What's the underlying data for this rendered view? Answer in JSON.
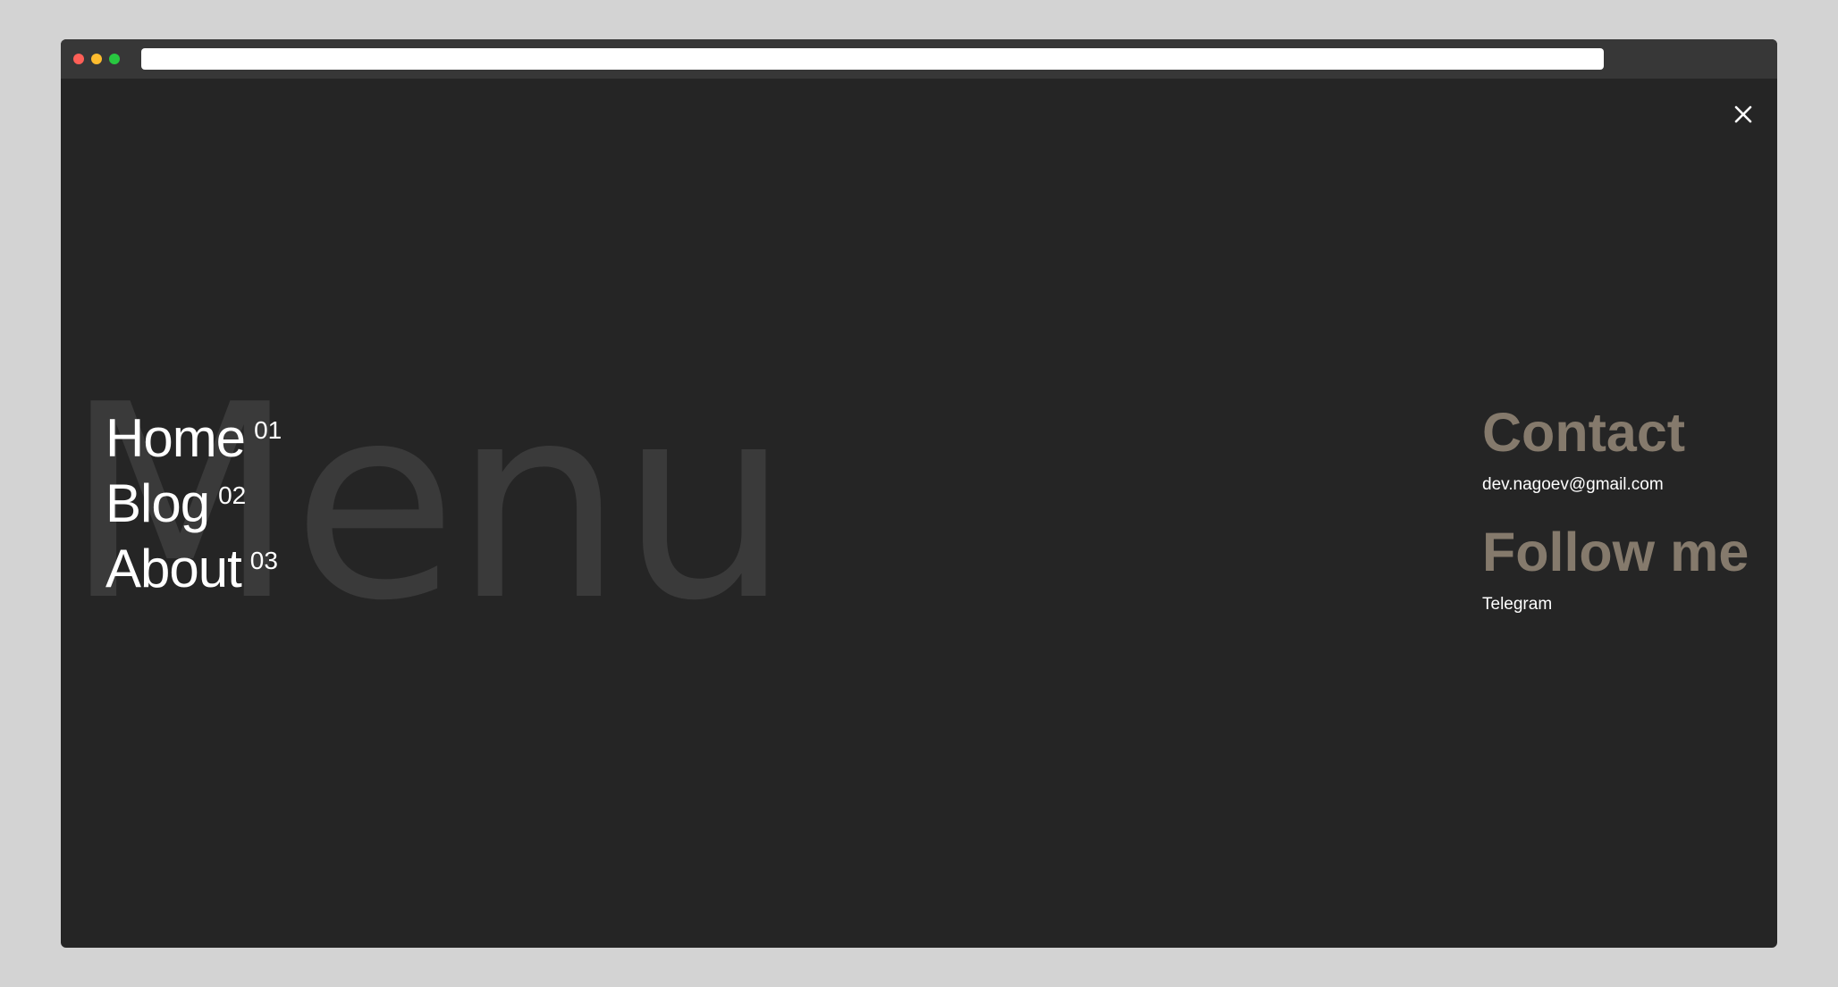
{
  "browser": {
    "url": ""
  },
  "menu": {
    "watermark": "Menu",
    "close_icon": "close-icon",
    "items": [
      {
        "label": "Home",
        "number": "01"
      },
      {
        "label": "Blog",
        "number": "02"
      },
      {
        "label": "About",
        "number": "03"
      }
    ]
  },
  "contact": {
    "heading": "Contact",
    "email": "dev.nagoev@gmail.com"
  },
  "follow": {
    "heading": "Follow me",
    "link": "Telegram"
  },
  "colors": {
    "background": "#252525",
    "accent": "#857a6c",
    "watermark": "#3a3a3a",
    "text": "#ffffff"
  }
}
